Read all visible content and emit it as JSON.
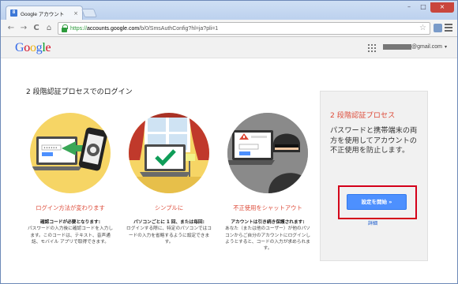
{
  "browser": {
    "tab_title": "Google アカウント",
    "tab_close": "×",
    "url_scheme": "https://",
    "url_host": "accounts.google.com",
    "url_path": "/b/0/SmsAuthConfig?hl=ja?pli=1",
    "back_icon": "←",
    "forward_icon": "→",
    "reload_icon": "C",
    "home_icon": "⌂",
    "star_icon": "☆",
    "window_buttons": {
      "minimize": "–",
      "maximize": "□",
      "close": "×"
    }
  },
  "header": {
    "logo": "Google",
    "logo_colors": [
      "#3369e8",
      "#d50f25",
      "#eeb211",
      "#3369e8",
      "#009925",
      "#d50f25"
    ],
    "account_suffix": "@gmail.com",
    "account_arrow": "▾"
  },
  "main": {
    "title": "2 段階認証プロセスでのログイン",
    "features": [
      {
        "title": "ログイン方法が変わります",
        "desc_bold": "確認コードが必要となります:",
        "desc": "パスワードの入力後に確認コードを入力します。このコードは、テキスト、音声通話、モバイル アプリで取得できます。",
        "icon": "phone-to-laptop-code-illustration"
      },
      {
        "title": "シンプルに",
        "desc_bold": "パソコンごとに 1 回、または毎回:",
        "desc": "ログインする際に、特定のパソコンではコードの入力を省略するように設定できます。",
        "icon": "laptop-checkmark-illustration"
      },
      {
        "title": "不正使用をシャットアウト",
        "desc_bold": "アカウントは引き続き保護されます:",
        "desc": "あなた（または他のユーザー）が他のパソコンからご自分のアカウントにログインしようとすると、コードの入力が求められます。",
        "icon": "thief-blocked-illustration"
      }
    ]
  },
  "sidebar": {
    "title": "2 段階認証プロセス",
    "description": "パスワードと携帯端末の両方を使用してアカウントの不正使用を防止します。",
    "start_button": "設定を開始 »",
    "details_link": "詳細"
  },
  "colors": {
    "accent_red": "#dd4b39",
    "button_blue": "#4d90fe",
    "highlight_red": "#d4001a",
    "link_blue": "#1155cc"
  }
}
